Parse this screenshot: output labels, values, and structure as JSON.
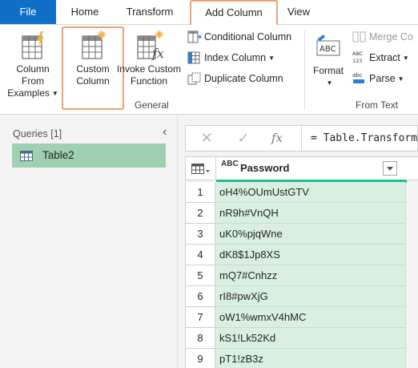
{
  "tabs": {
    "file": "File",
    "home": "Home",
    "transform": "Transform",
    "add_column": "Add Column",
    "view": "View"
  },
  "ribbon": {
    "general": {
      "label": "General",
      "column_from_examples": [
        "Column From",
        "Examples"
      ],
      "custom_column": [
        "Custom",
        "Column"
      ],
      "invoke_custom_function": [
        "Invoke Custom",
        "Function"
      ],
      "conditional_column": "Conditional Column",
      "index_column": "Index Column",
      "duplicate_column": "Duplicate Column"
    },
    "from_text": {
      "label": "From Text",
      "format": "Format",
      "merge_columns": "Merge Co",
      "extract": "Extract",
      "parse": "Parse",
      "abc_label": "ABC",
      "abc123_label": "ABC 123",
      "abc_parse_label": "abc"
    }
  },
  "queries": {
    "header": "Queries [1]",
    "items": [
      "Table2"
    ]
  },
  "formula_bar": {
    "fx": "fx",
    "text": "= Table.Transform"
  },
  "table": {
    "column_type": "ABC",
    "column_name": "Password",
    "rows": [
      {
        "num": "1",
        "value": "oH4%OUmUstGTV"
      },
      {
        "num": "2",
        "value": "nR9h#VnQH"
      },
      {
        "num": "3",
        "value": "uK0%pjqWne"
      },
      {
        "num": "4",
        "value": "dK8$1Jp8XS"
      },
      {
        "num": "5",
        "value": "mQ7#Cnhzz"
      },
      {
        "num": "6",
        "value": "rI8#pwXjG"
      },
      {
        "num": "7",
        "value": "oW1%wmxV4hMC"
      },
      {
        "num": "8",
        "value": "kS1!Lk52Kd"
      },
      {
        "num": "9",
        "value": "pT1!zB3z"
      }
    ]
  },
  "colors": {
    "file_tab": "#0f6fc6",
    "highlight": "#e9a27a",
    "query_selected": "#9ed0b1",
    "quality_bar": "#1cbf8e",
    "cell_bg": "#d9efe2"
  }
}
